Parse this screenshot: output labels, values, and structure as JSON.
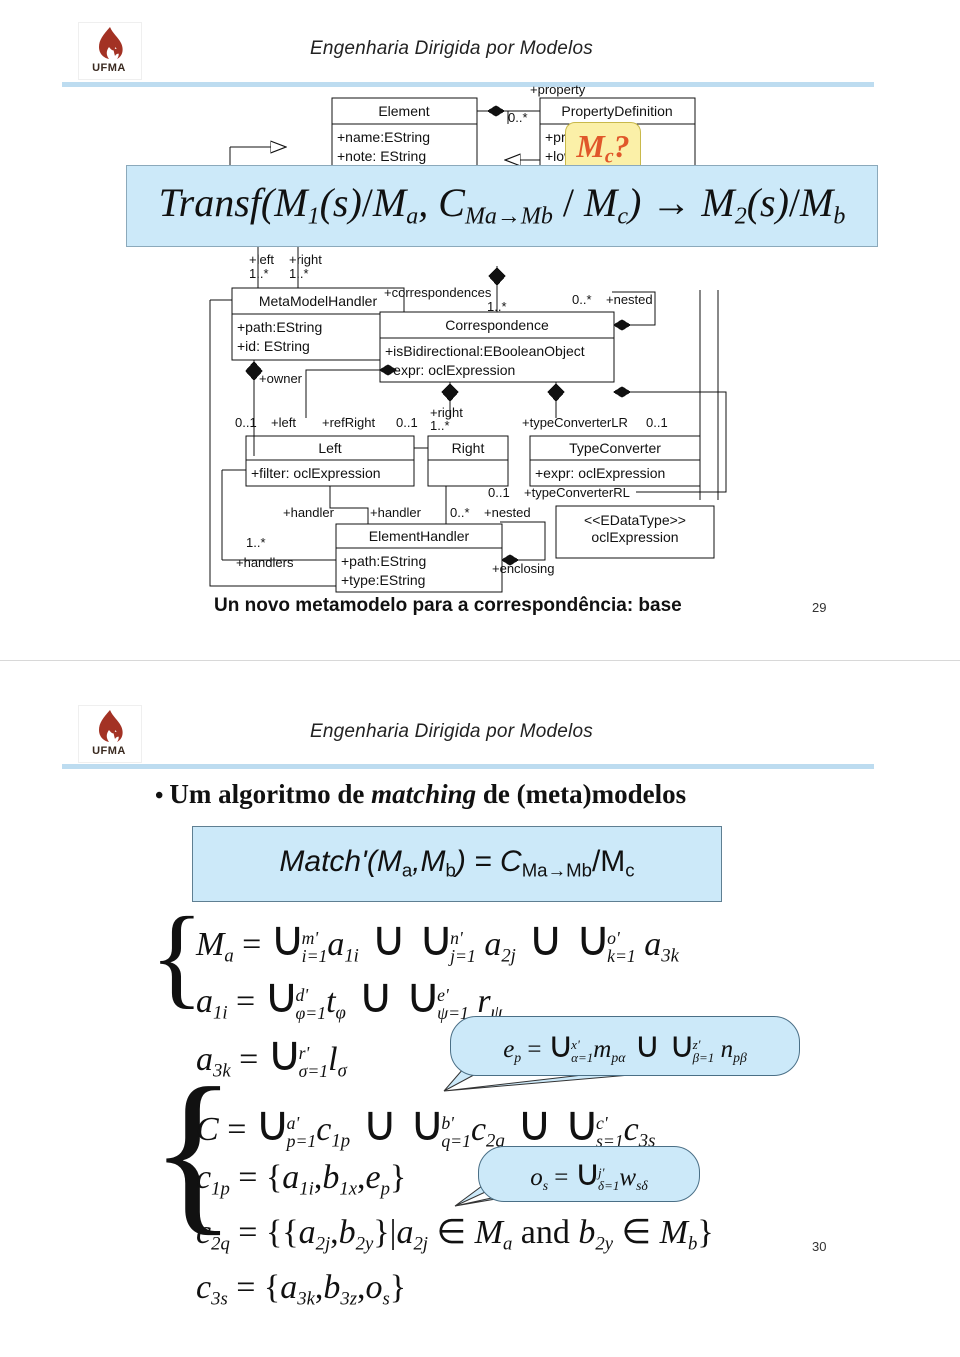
{
  "document": {
    "kind": "lecture-slides",
    "slides": [
      {
        "number": "29",
        "header_title": "Engenharia Dirigida por Modelos",
        "logo_text": "UFMA",
        "caption": "Un novo metamodelo para a correspondência: base",
        "banner_formula": "Transf(M1(s)/Ma, CMa→Mb/Mc) → M2(s)/Mb",
        "callout": {
          "label": "Mc?"
        },
        "diagram": {
          "type": "uml-class-diagram",
          "classes": [
            {
              "id": "element",
              "name": "Element",
              "attributes": [
                "+name:EString",
                "+note: EString"
              ]
            },
            {
              "id": "propertydef",
              "name": "PropertyDefinition",
              "attributes": [
                "+prop",
                "+lower"
              ]
            },
            {
              "id": "metamodelhandler",
              "name": "MetaModelHandler",
              "attributes": [
                "+path:EString",
                "+id: EString"
              ]
            },
            {
              "id": "correspondence",
              "name": "Correspondence",
              "attributes": [
                "+isBidirectional:EBooleanObject",
                "+expr: oclExpression"
              ]
            },
            {
              "id": "left",
              "name": "Left",
              "attributes": [
                "+filter: oclExpression"
              ]
            },
            {
              "id": "right",
              "name": "Right",
              "attributes": []
            },
            {
              "id": "typeconverter",
              "name": "TypeConverter",
              "attributes": [
                "+expr: oclExpression"
              ]
            },
            {
              "id": "elementhandler",
              "name": "ElementHandler",
              "attributes": [
                "+path:EString",
                "+type:EString"
              ]
            },
            {
              "id": "edatatype",
              "name": "<<EDataType>>",
              "attributes": [
                "oclExpression"
              ]
            }
          ],
          "association_labels": [
            "+property",
            "0..*",
            "+left",
            "1..*",
            "+right",
            "1..*",
            "+correspondences",
            "1..*",
            "0..*",
            "+nested",
            "+owner",
            "0..1",
            "+left",
            "+refRight",
            "0..1",
            "+right",
            "1..*",
            "+typeConverterLR",
            "0..1",
            "0..1",
            "+typeConverterRL",
            "+handler",
            "+handler",
            "0..*",
            "+nested",
            "1..*",
            "+handlers",
            "+enclosing"
          ]
        }
      },
      {
        "number": "30",
        "header_title": "Engenharia Dirigida por Modelos",
        "logo_text": "UFMA",
        "bullet": {
          "prefix": "Um algoritmo de ",
          "italic": "matching",
          "suffix": " de (meta)modelos"
        },
        "match_box": "Match'(Ma,Mb) = CMa→Mb/Mc",
        "equations": [
          {
            "id": "Ma",
            "text": "Ma = ∪(i=1..m') a1i ∪ ∪(j=1..n') a2j ∪ ∪(k=1..o') a3k"
          },
          {
            "id": "a1i",
            "text": "a1i = ∪(φ=1..d') tφ ∪ ∪(ψ=1..e') rψ"
          },
          {
            "id": "a3k",
            "text": "a3k = ∪(σ=1..r') lσ"
          },
          {
            "id": "C",
            "text": "C = ∪(p=1..a') c1p ∪ ∪(q=1..b') c2q ∪ ∪(s=1..c') c3s"
          },
          {
            "id": "c1p",
            "text": "c1p = {a1i, b1x, ep}"
          },
          {
            "id": "c2q",
            "text": "c2q = {{a2j, b2y} | a2j ∈ Ma and b2y ∈ Mb}"
          },
          {
            "id": "c3s",
            "text": "c3s = {a3k, b3z, os}"
          }
        ],
        "callouts": [
          {
            "id": "ep",
            "text": "ep = ∪(α=1..x') mpα ∪ ∪(β=1..z') npβ"
          },
          {
            "id": "os",
            "text": "os = ∪(δ=1..j') wsδ"
          }
        ]
      }
    ]
  },
  "colors": {
    "banner_fill": "#cce9f9",
    "banner_border": "#8ba9bb",
    "callout_yellow_fill": "#fbf0a8",
    "callout_yellow_border": "#c9b94b",
    "callout_text": "#e0572a",
    "rule": "#bddcf0",
    "logo_flame": "#a33224"
  }
}
